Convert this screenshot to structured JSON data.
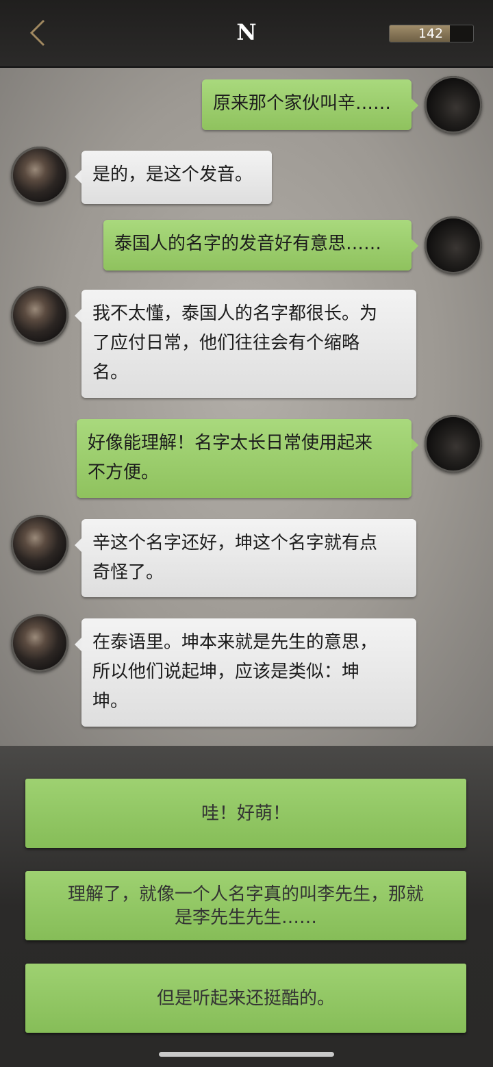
{
  "header": {
    "title": "N",
    "counter_value": "142",
    "counter_fill_fraction": 0.72
  },
  "messages": [
    {
      "side": "right",
      "text": "原来那个家伙叫辛……"
    },
    {
      "side": "left",
      "text": "是的，是这个发音。"
    },
    {
      "side": "right",
      "text": "泰国人的名字的发音好有意思……"
    },
    {
      "side": "left",
      "text": "我不太懂，泰国人的名字都很长。为\n了应付日常，他们往往会有个缩略\n名。"
    },
    {
      "side": "right",
      "text": "好像能理解！名字太长日常使用起来\n不方便。"
    },
    {
      "side": "left",
      "text": "辛这个名字还好，坤这个名字就有点\n奇怪了。"
    },
    {
      "side": "left",
      "text": "在泰语里。坤本来就是先生的意思，\n所以他们说起坤，应该是类似：坤\n坤。"
    }
  ],
  "choices": [
    {
      "label": "哇！好萌！"
    },
    {
      "label": "理解了，就像一个人名字真的叫李先生，那就\n是李先生先生……"
    },
    {
      "label": "但是听起来还挺酷的。"
    }
  ],
  "icons": {
    "back": "chevron-left-icon"
  },
  "colors": {
    "accent_green": "#9ccd6c",
    "bubble_white": "#ececec",
    "back_chevron": "#a08860"
  }
}
